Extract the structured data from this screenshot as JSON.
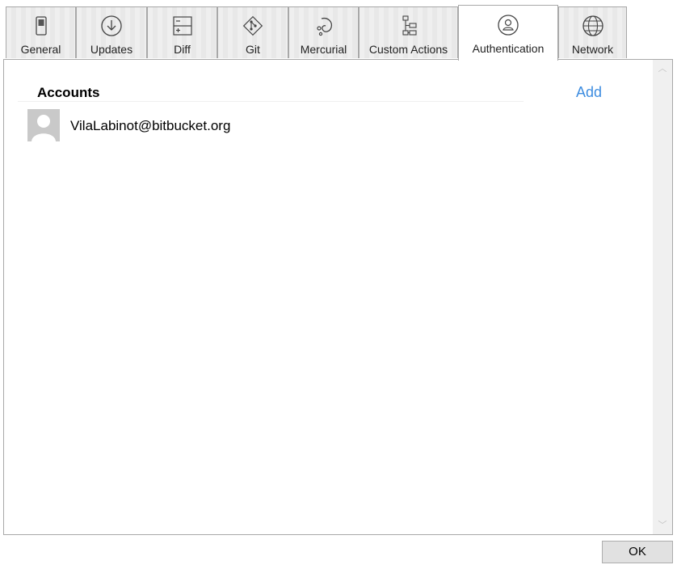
{
  "tabs": [
    {
      "label": "General",
      "icon": "toggle-switch-icon"
    },
    {
      "label": "Updates",
      "icon": "download-circle-icon"
    },
    {
      "label": "Diff",
      "icon": "diff-icon"
    },
    {
      "label": "Git",
      "icon": "git-icon"
    },
    {
      "label": "Mercurial",
      "icon": "mercurial-icon"
    },
    {
      "label": "Custom Actions",
      "icon": "flowchart-icon"
    },
    {
      "label": "Authentication",
      "icon": "user-circle-icon"
    },
    {
      "label": "Network",
      "icon": "globe-icon"
    }
  ],
  "active_tab": "Authentication",
  "accounts": {
    "title": "Accounts",
    "add_label": "Add",
    "items": [
      {
        "email": "VilaLabinot@bitbucket.org"
      }
    ]
  },
  "footer": {
    "ok_label": "OK"
  },
  "colors": {
    "link": "#3e8de0",
    "border": "#a8a8a8",
    "avatar_bg": "#c9c9c9"
  }
}
